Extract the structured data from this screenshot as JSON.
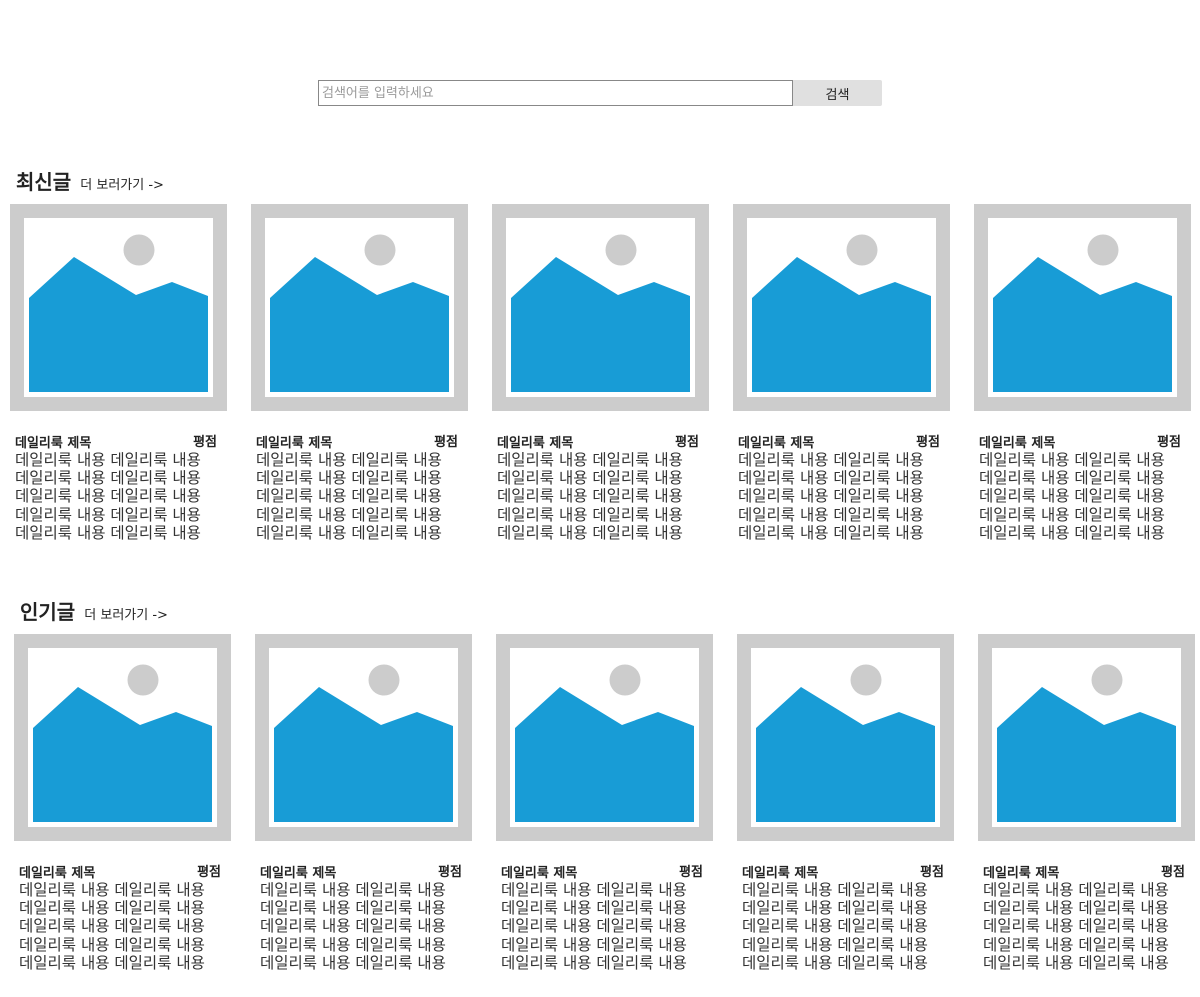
{
  "search": {
    "placeholder": "검색어를 입력하세요",
    "button_label": "검색"
  },
  "sections": [
    {
      "title": "최신글",
      "more_label": "더 보러가기 ->",
      "cards": [
        {
          "title": "데일리룩 제목",
          "rating_label": "평점",
          "body": [
            "데일리룩 내용 데일리룩 내용",
            "데일리룩 내용 데일리룩 내용",
            "데일리룩 내용 데일리룩 내용",
            "데일리룩 내용 데일리룩 내용",
            "데일리룩 내용 데일리룩 내용"
          ]
        },
        {
          "title": "데일리룩 제목",
          "rating_label": "평점",
          "body": [
            "데일리룩 내용 데일리룩 내용",
            "데일리룩 내용 데일리룩 내용",
            "데일리룩 내용 데일리룩 내용",
            "데일리룩 내용 데일리룩 내용",
            "데일리룩 내용 데일리룩 내용"
          ]
        },
        {
          "title": "데일리룩 제목",
          "rating_label": "평점",
          "body": [
            "데일리룩 내용 데일리룩 내용",
            "데일리룩 내용 데일리룩 내용",
            "데일리룩 내용 데일리룩 내용",
            "데일리룩 내용 데일리룩 내용",
            "데일리룩 내용 데일리룩 내용"
          ]
        },
        {
          "title": "데일리룩 제목",
          "rating_label": "평점",
          "body": [
            "데일리룩 내용 데일리룩 내용",
            "데일리룩 내용 데일리룩 내용",
            "데일리룩 내용 데일리룩 내용",
            "데일리룩 내용 데일리룩 내용",
            "데일리룩 내용 데일리룩 내용"
          ]
        },
        {
          "title": "데일리룩 제목",
          "rating_label": "평점",
          "body": [
            "데일리룩 내용 데일리룩 내용",
            "데일리룩 내용 데일리룩 내용",
            "데일리룩 내용 데일리룩 내용",
            "데일리룩 내용 데일리룩 내용",
            "데일리룩 내용 데일리룩 내용"
          ]
        }
      ]
    },
    {
      "title": "인기글",
      "more_label": "더 보러가기 ->",
      "cards": [
        {
          "title": "데일리룩 제목",
          "rating_label": "평점",
          "body": [
            "데일리룩 내용 데일리룩 내용",
            "데일리룩 내용 데일리룩 내용",
            "데일리룩 내용 데일리룩 내용",
            "데일리룩 내용 데일리룩 내용",
            "데일리룩 내용 데일리룩 내용"
          ]
        },
        {
          "title": "데일리룩 제목",
          "rating_label": "평점",
          "body": [
            "데일리룩 내용 데일리룩 내용",
            "데일리룩 내용 데일리룩 내용",
            "데일리룩 내용 데일리룩 내용",
            "데일리룩 내용 데일리룩 내용",
            "데일리룩 내용 데일리룩 내용"
          ]
        },
        {
          "title": "데일리룩 제목",
          "rating_label": "평점",
          "body": [
            "데일리룩 내용 데일리룩 내용",
            "데일리룩 내용 데일리룩 내용",
            "데일리룩 내용 데일리룩 내용",
            "데일리룩 내용 데일리룩 내용",
            "데일리룩 내용 데일리룩 내용"
          ]
        },
        {
          "title": "데일리룩 제목",
          "rating_label": "평점",
          "body": [
            "데일리룩 내용 데일리룩 내용",
            "데일리룩 내용 데일리룩 내용",
            "데일리룩 내용 데일리룩 내용",
            "데일리룩 내용 데일리룩 내용",
            "데일리룩 내용 데일리룩 내용"
          ]
        },
        {
          "title": "데일리룩 제목",
          "rating_label": "평점",
          "body": [
            "데일리룩 내용 데일리룩 내용",
            "데일리룩 내용 데일리룩 내용",
            "데일리룩 내용 데일리룩 내용",
            "데일리룩 내용 데일리룩 내용",
            "데일리룩 내용 데일리룩 내용"
          ]
        }
      ]
    }
  ],
  "colors": {
    "placeholder_frame": "#cccccc",
    "placeholder_mountain": "#189cd6",
    "placeholder_sun": "#cccccc",
    "search_button_bg": "#e0e0e0"
  },
  "icons": {
    "thumbnail": "image-placeholder-icon"
  }
}
